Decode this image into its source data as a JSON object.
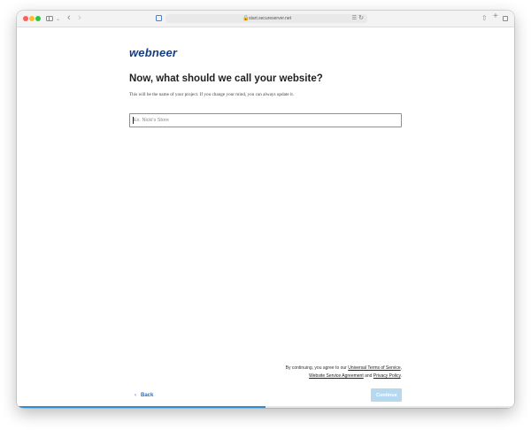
{
  "browser": {
    "url": "start.secureserver.net"
  },
  "brand": {
    "logo_text": "webneer",
    "logo_color": "#153d82"
  },
  "page": {
    "heading": "Now, what should we call your website?",
    "subtext": "This will be the name of your project. If you change your mind, you can always update it."
  },
  "site_name_input": {
    "placeholder": "Ex. Nicki's Store",
    "value": ""
  },
  "footer": {
    "terms_prefix": "By continuing, you agree to our ",
    "terms_link_1": "Universal Terms of Service",
    "terms_sep_1": ",",
    "terms_link_2": "Website Service Agreement",
    "terms_sep_2": " and ",
    "terms_link_3": "Privacy Policy",
    "terms_suffix": ".",
    "back_label": "Back",
    "continue_label": "Continue"
  },
  "progress": {
    "fraction": 0.5,
    "color": "#2d8fd0"
  },
  "colors": {
    "accent": "#2d6db7",
    "continue_disabled": "#b7d8f1"
  }
}
